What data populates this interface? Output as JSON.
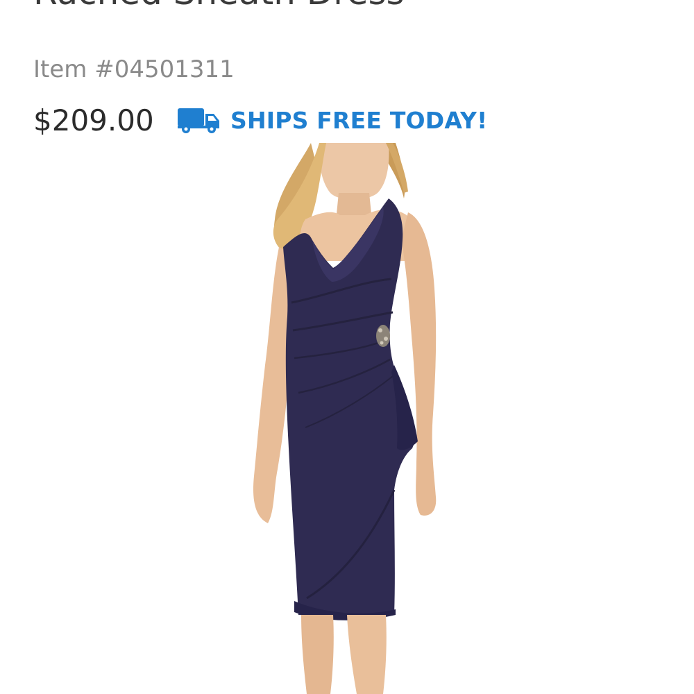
{
  "product": {
    "title": "Ruched Sheath Dress",
    "item_number": "Item #04501311",
    "price": "$209.00",
    "shipping_text": "SHIPS FREE TODAY!",
    "shipping_icon": "truck-icon",
    "image_alt": "Navy ruched sheath dress worn by model"
  },
  "colors": {
    "accent": "#1f7fd0",
    "dress": "#2f2b52"
  }
}
